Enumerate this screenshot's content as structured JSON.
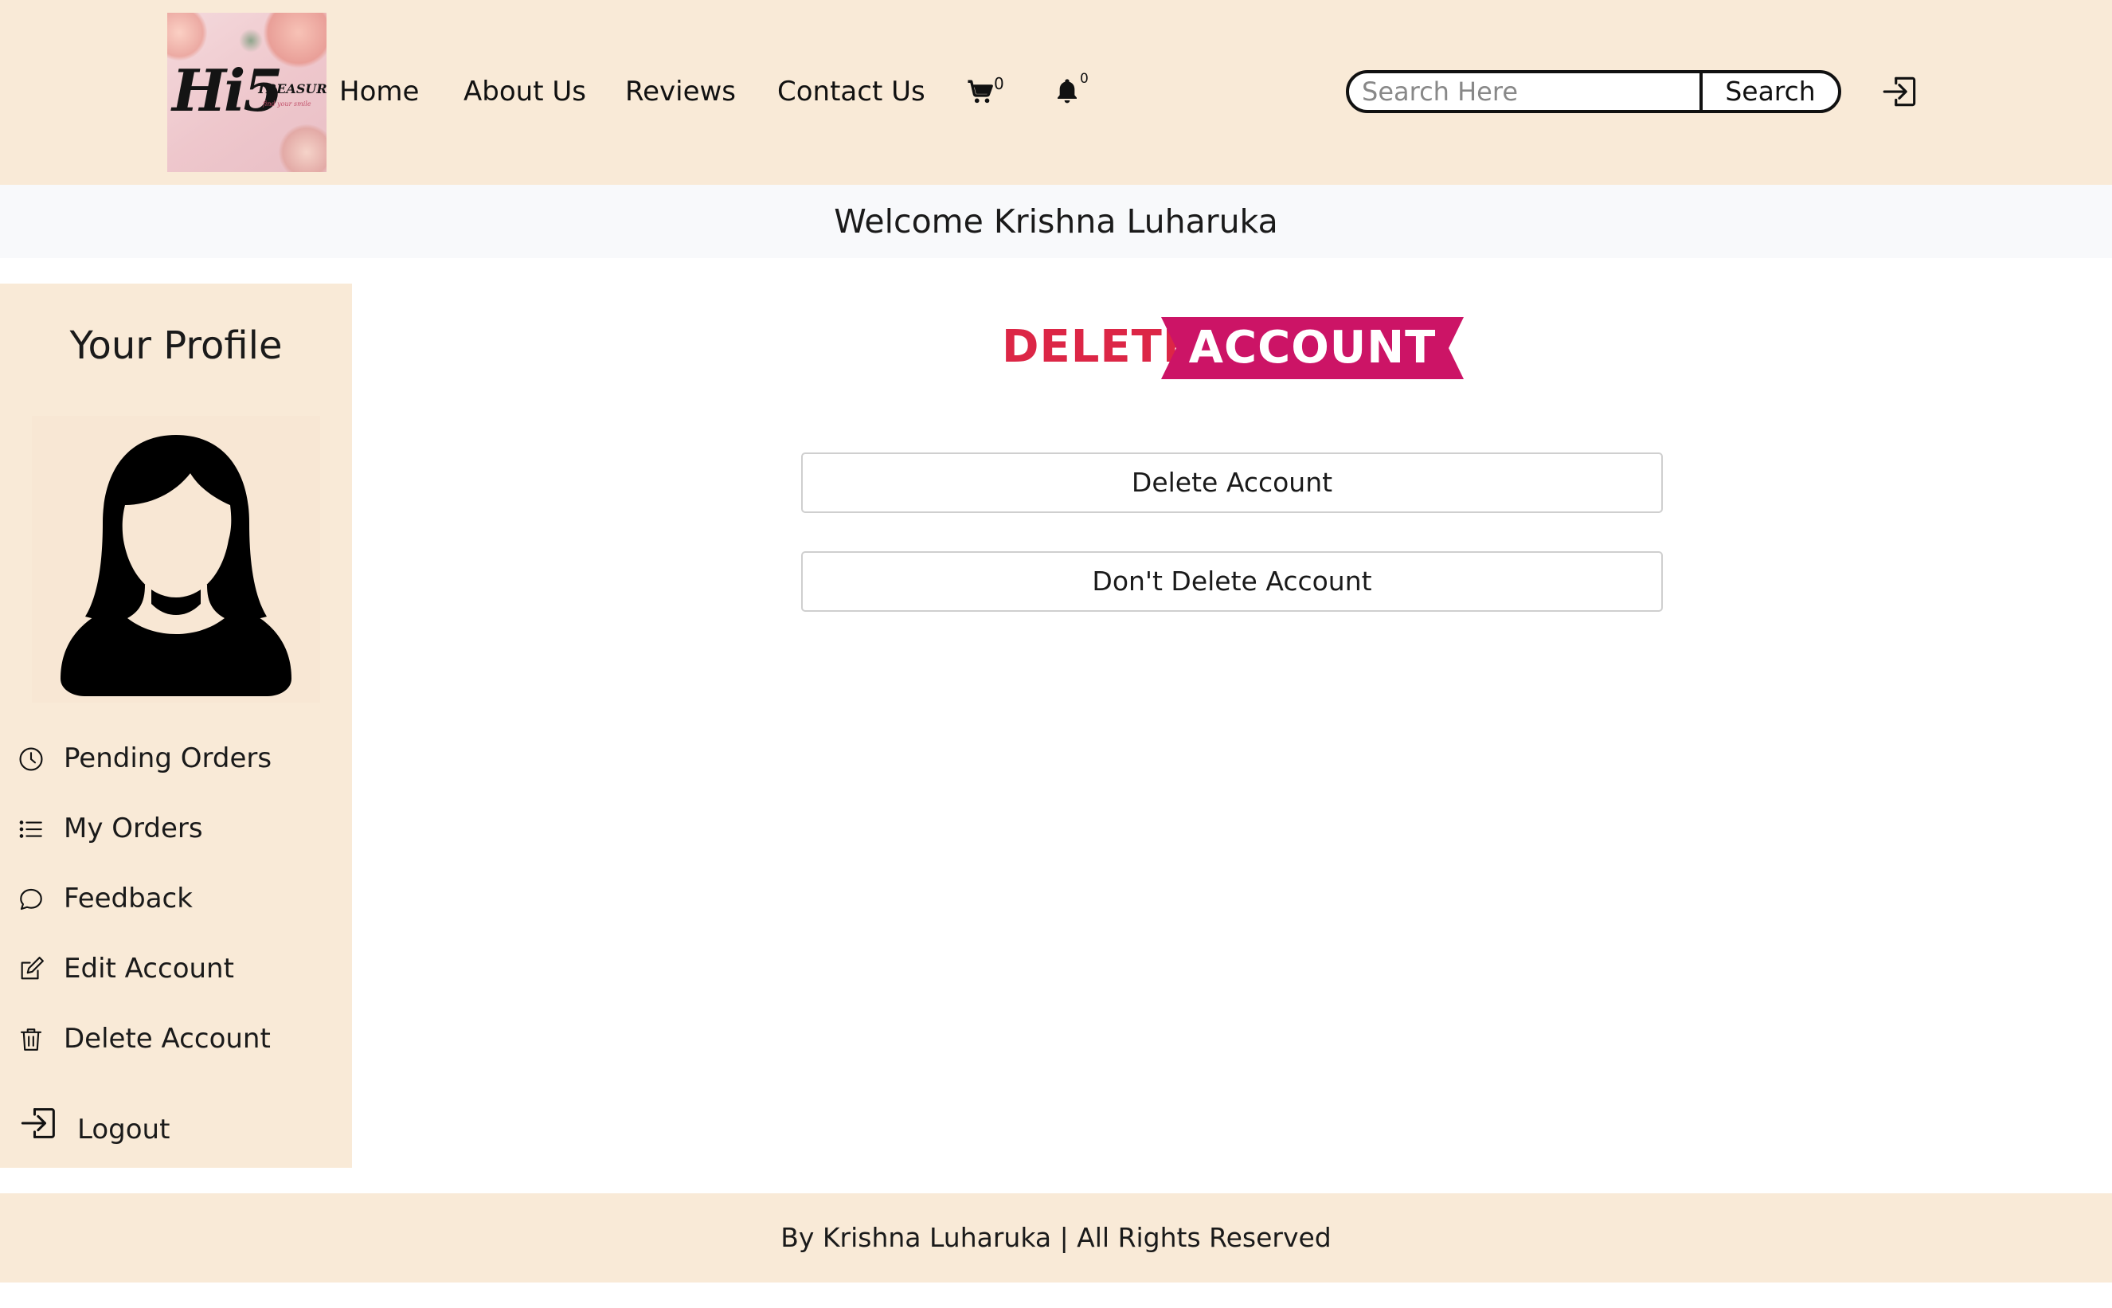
{
  "header": {
    "logo": {
      "brand": "Hi5",
      "sub": "TREASURES",
      "tagline": "find your smile"
    },
    "nav": [
      {
        "label": "Home"
      },
      {
        "label": "About Us"
      },
      {
        "label": "Reviews"
      },
      {
        "label": "Contact Us"
      }
    ],
    "cart": {
      "icon": "cart-icon",
      "count": "0"
    },
    "notifications": {
      "icon": "bell-icon",
      "count": "0"
    },
    "search": {
      "placeholder": "Search Here",
      "value": "",
      "button_label": "Search"
    },
    "login_icon": "login-icon"
  },
  "welcome": {
    "text": "Welcome Krishna Luharuka"
  },
  "sidebar": {
    "title": "Your Profile",
    "avatar_icon": "female-user-icon",
    "items": [
      {
        "label": "Pending Orders",
        "icon": "clock-icon"
      },
      {
        "label": "My Orders",
        "icon": "list-icon"
      },
      {
        "label": "Feedback",
        "icon": "chat-bubble-icon"
      },
      {
        "label": "Edit Account",
        "icon": "edit-icon"
      },
      {
        "label": "Delete Account",
        "icon": "trash-icon"
      },
      {
        "label": "Logout",
        "icon": "logout-icon"
      }
    ]
  },
  "main": {
    "heading_part1": "DELETE",
    "heading_part2": "ACCOUNT",
    "delete_button_label": "Delete Account",
    "keep_button_label": "Don't Delete Account"
  },
  "footer": {
    "text": "By Krishna Luharuka | All Rights Reserved"
  },
  "colors": {
    "header_bg": "#f9ead7",
    "heading_red": "#dc2646",
    "ribbon_magenta": "#cc1466"
  }
}
